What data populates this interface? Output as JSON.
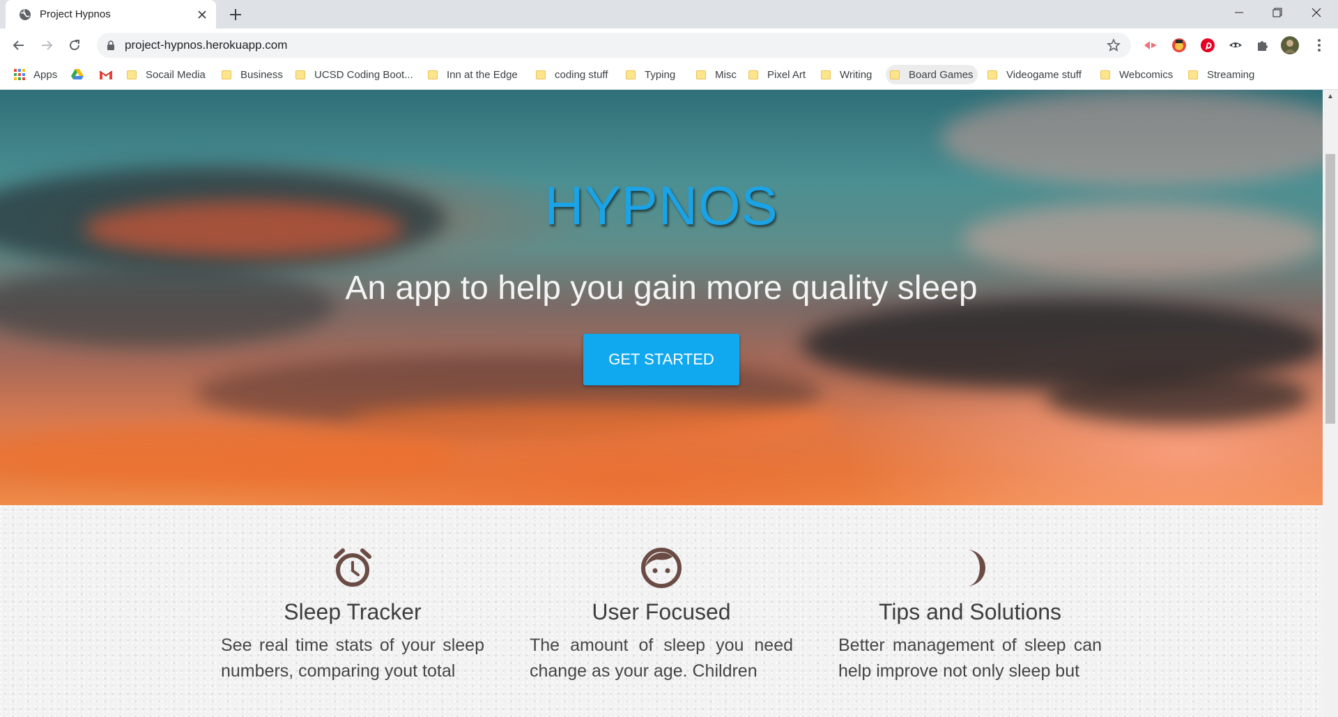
{
  "browser": {
    "tab_title": "Project Hypnos",
    "url": "project-hypnos.herokuapp.com",
    "bookmarks": [
      "Apps",
      "Socail Media",
      "Business",
      "UCSD Coding Boot...",
      "Inn at the Edge",
      "coding stuff",
      "Typing",
      "Misc",
      "Pixel Art",
      "Writing",
      "Board Games",
      "Videogame stuff",
      "Webcomics",
      "Streaming"
    ]
  },
  "hero": {
    "title": "HYPNOS",
    "subtitle": "An app to help you gain more quality sleep",
    "cta_label": "GET STARTED"
  },
  "features": [
    {
      "icon": "alarm-clock-icon",
      "heading": "Sleep Tracker",
      "text": "See real time stats of your sleep numbers, comparing yout total"
    },
    {
      "icon": "face-icon",
      "heading": "User Focused",
      "text": "The amount of sleep you need change as your age. Children"
    },
    {
      "icon": "moon-icon",
      "heading": "Tips and Solutions",
      "text": "Better management of sleep can help improve not only sleep but"
    }
  ],
  "colors": {
    "brand": "#1aa3e6",
    "button": "#10a8ee",
    "icon": "#6b4c45"
  }
}
